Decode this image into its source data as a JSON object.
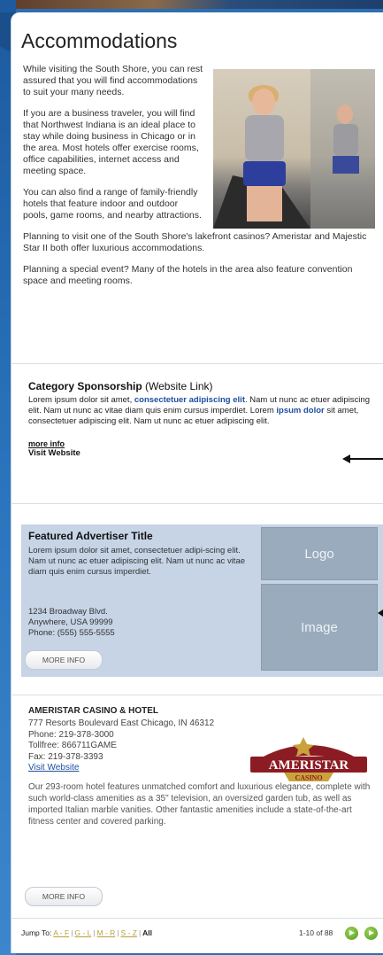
{
  "page": {
    "title": "Accommodations"
  },
  "intro": {
    "p1": "While visiting the South Shore, you can rest assured that you will find accommodations to suit your many needs.",
    "p2": "If you are a business traveler, you will find that Northwest Indiana is an ideal place to stay while doing business in Chicago or in the area. Most hotels offer exercise rooms, office capabilities, internet access and meeting space.",
    "p3": "You can also find a range of family-friendly hotels that feature indoor and outdoor pools, game rooms, and nearby attractions.",
    "p4": "Planning to visit one of the South Shore's lakefront casinos? Ameristar and Majestic Star II both offer luxurious accommodations.",
    "p5": "Planning a special event? Many of the hotels in the area also feature convention space and meeting rooms."
  },
  "sponsor": {
    "title": "Category Sponsorship",
    "title_note": " (Website Link)",
    "text_a": "Lorem ipsum dolor sit amet, ",
    "text_hl1": "consectetuer adipiscing elit",
    "text_b": ". Nam ut nunc ac etuer adipiscing elit. Nam ut nunc ac vitae diam quis enim cursus imperdiet. Lorem ",
    "text_hl2": "ipsum dolor",
    "text_c": " sit amet, consectetuer adipiscing elit. Nam ut nunc ac etuer adipiscing elit.",
    "more_info": "more info",
    "visit": "Visit Website"
  },
  "featured": {
    "title": "Featured Advertiser Title",
    "desc": "Lorem ipsum dolor sit amet, consectetuer adipi-scing elit. Nam ut nunc ac etuer adipiscing elit. Nam ut nunc ac vitae diam quis enim cursus imperdiet.",
    "addr1": "1234 Broadway Blvd.",
    "addr2": "Anywhere, USA 99999",
    "phone": "Phone: (555) 555-5555",
    "button": "MORE INFO",
    "logo_label": "Logo",
    "image_label": "Image"
  },
  "listing": {
    "name": "AMERISTAR CASINO & HOTEL",
    "address": "777 Resorts Boulevard East Chicago, IN 46312",
    "phone": "Phone: 219-378-3000",
    "tollfree": "Tollfree: 866711GAME",
    "fax": "Fax: 219-378-3393",
    "website": "Visit Website",
    "description": "Our 293-room hotel features unmatched comfort and luxurious elegance, complete with such world-class amenities as a 35\" television, an oversized garden tub, as well as imported Italian marble vanities. Other fantastic amenities include a state-of-the-art fitness center and covered parking.",
    "button": "MORE INFO",
    "logo_top": "AMERISTAR",
    "logo_bottom": "CASINO"
  },
  "footer": {
    "jump_label": "Jump To: ",
    "ranges": [
      "A - F",
      "G - L",
      "M - R",
      "S - Z"
    ],
    "all": "All",
    "count": "1-10  of  88"
  },
  "colors": {
    "frame": "#2e6fb0",
    "featured_bg": "#c6d4e6",
    "placeholder": "#9aabbd",
    "link": "#1f4fa0",
    "jump_link": "#b8a23a",
    "pager": "#5aa526"
  }
}
